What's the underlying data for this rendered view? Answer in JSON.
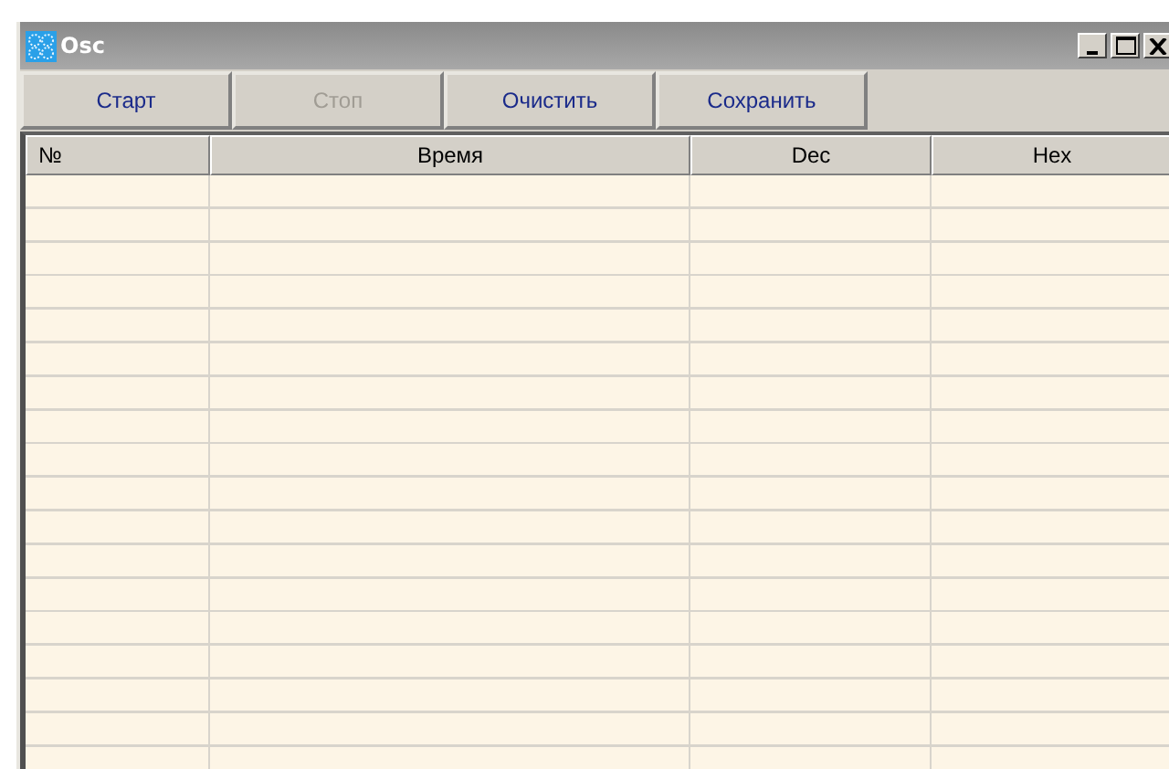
{
  "window": {
    "title": "Osc"
  },
  "buttons": [
    {
      "label": "Старт",
      "disabled": false
    },
    {
      "label": "Стоп",
      "disabled": true
    },
    {
      "label": "Очистить",
      "disabled": false
    },
    {
      "label": "Сохранить",
      "disabled": false
    }
  ],
  "table": {
    "columns": [
      "№",
      "Время",
      "Dec",
      "Hex"
    ]
  }
}
